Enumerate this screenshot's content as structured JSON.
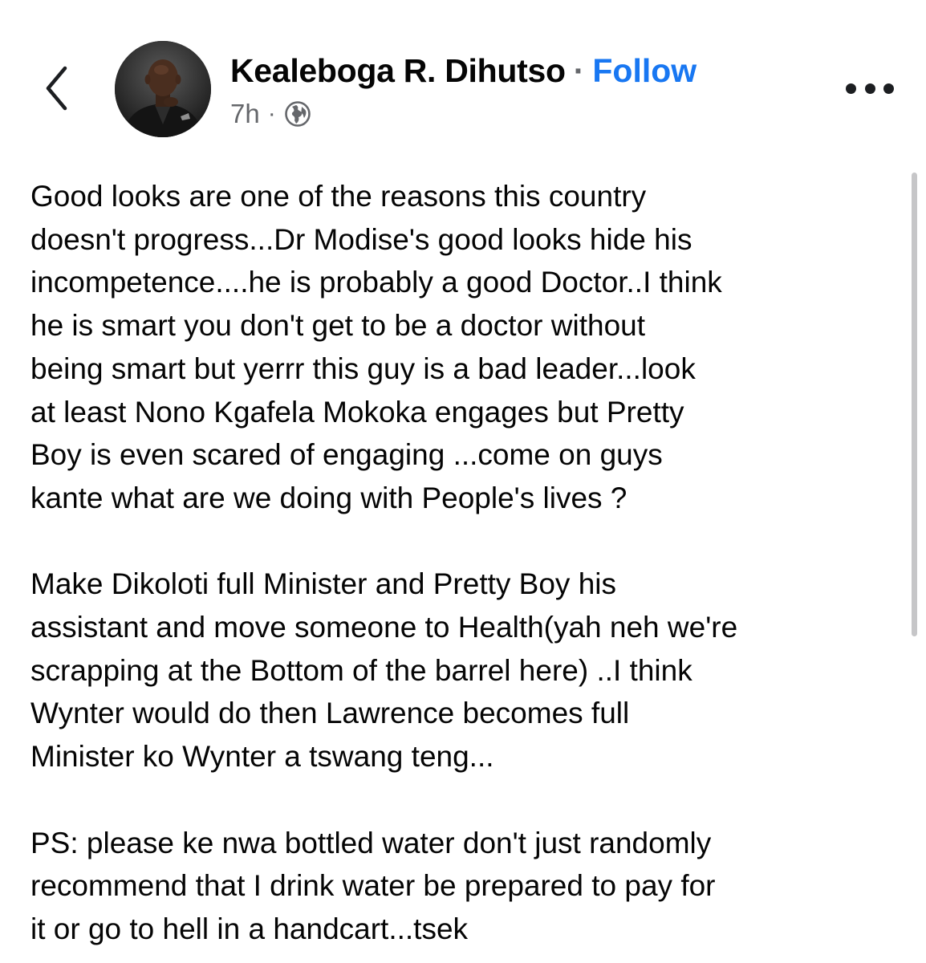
{
  "header": {
    "back_icon": "chevron-left-icon",
    "author_name": "Kealeboga R. Dihutso",
    "separator": "·",
    "follow_label": "Follow",
    "time_ago": "7h",
    "meta_separator": "·",
    "audience_icon": "globe-icon",
    "more_icon": "more-horizontal-icon"
  },
  "post": {
    "paragraphs": [
      "Good looks are one of the reasons this country\ndoesn't progress...Dr Modise's good looks hide his\nincompetence....he is probably a good Doctor..I think\nhe is smart you don't get to be a doctor without\nbeing smart  but yerrr this guy is a bad leader...look\nat least Nono Kgafela Mokoka engages but Pretty\nBoy is even scared of engaging ...come on guys\nkante what are we doing with People's lives ?",
      "Make Dikoloti full Minister and Pretty Boy his\nassistant and move someone to Health(yah neh we're\nscrapping at the Bottom of the barrel here) ..I think\nWynter would do then Lawrence becomes full\nMinister ko Wynter a tswang teng...",
      "PS: please ke nwa bottled water don't just randomly\nrecommend that I drink water be prepared to pay for\nit or go to hell in a handcart...tsek"
    ]
  },
  "colors": {
    "text": "#050505",
    "secondary_text": "#65676b",
    "follow_blue": "#1877f2",
    "scrollbar": "#c6c6c8"
  }
}
